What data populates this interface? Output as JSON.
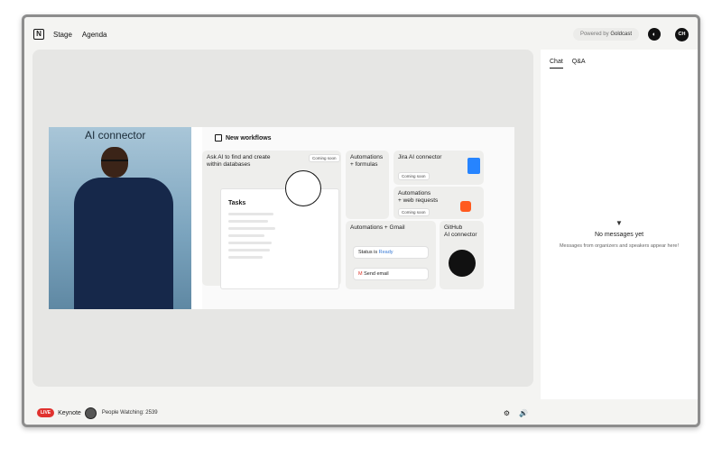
{
  "topbar": {
    "nav": [
      "Stage",
      "Agenda"
    ],
    "powered_by": "Powered by",
    "powered_brand": "Goldcast",
    "user_initials": "CH"
  },
  "video": {
    "speaker_overlay_title": "AI connector",
    "slide": {
      "header": "New workflows",
      "ask_ai": "Ask AI to find and create\nwithin databases",
      "coming_soon": "Coming soon",
      "tasks_title": "Tasks",
      "automations_formulas": "Automations\n+ formulas",
      "jira": "Jira AI connector",
      "automations_web": "Automations\n+ web requests",
      "automations_gmail": "Automations + Gmail",
      "status_label": "Status is",
      "status_value": "Ready",
      "send_email": "Send email",
      "github": "GitHub\nAI connector"
    }
  },
  "chat": {
    "tabs": [
      "Chat",
      "Q&A"
    ],
    "empty_title": "No messages yet",
    "empty_subtitle": "Messages from organizers and speakers appear here!"
  },
  "bottombar": {
    "live_badge": "LIVE",
    "session": "Keynote",
    "watching": "People Watching: 2539"
  },
  "icons": [
    "logo-icon",
    "theme-icon",
    "filter-icon",
    "settings-icon",
    "volume-icon"
  ],
  "colors": {
    "live": "#e0322f",
    "accent": "#3a7bd5"
  }
}
